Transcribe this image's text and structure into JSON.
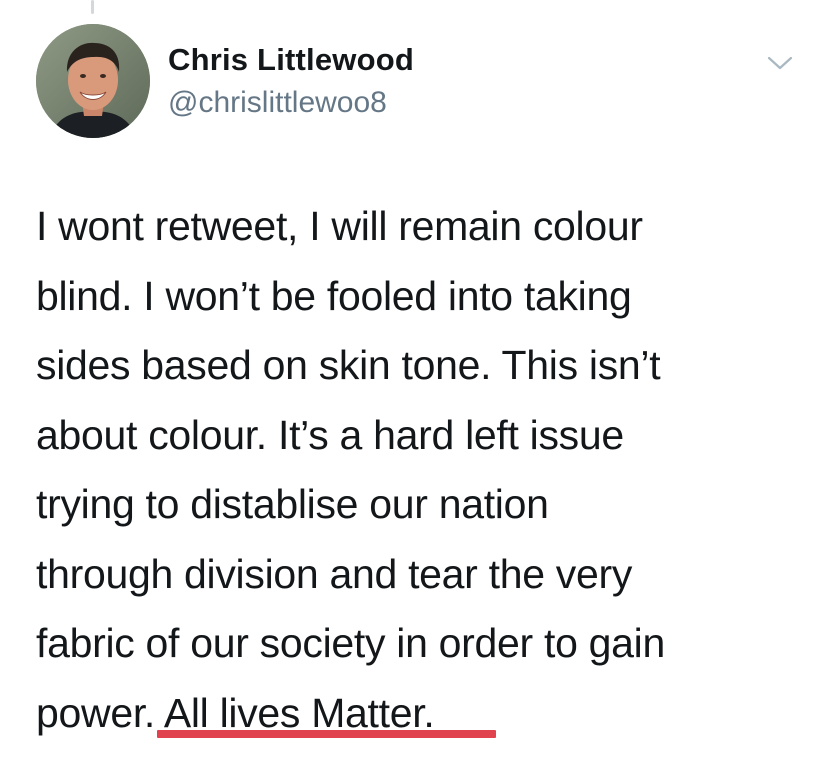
{
  "tweet": {
    "author": {
      "display_name": "Chris Littlewood",
      "handle": "@chrislittlewoo8",
      "avatar_icon": "profile-photo"
    },
    "menu_icon": "chevron-down-icon",
    "text_lines": [
      "I wont retweet, I will remain colour",
      "blind. I won’t be fooled into taking",
      "sides based on skin tone. This isn’t",
      "about colour. It’s a hard left issue",
      "trying to distablise our nation",
      "through division and tear the very",
      "fabric of our society in order to gain",
      "power. All lives Matter."
    ]
  },
  "colors": {
    "text_primary": "#14171a",
    "text_secondary": "#657786",
    "highlight_underline": "#e0434e",
    "thread_line": "#d3d8dc"
  }
}
